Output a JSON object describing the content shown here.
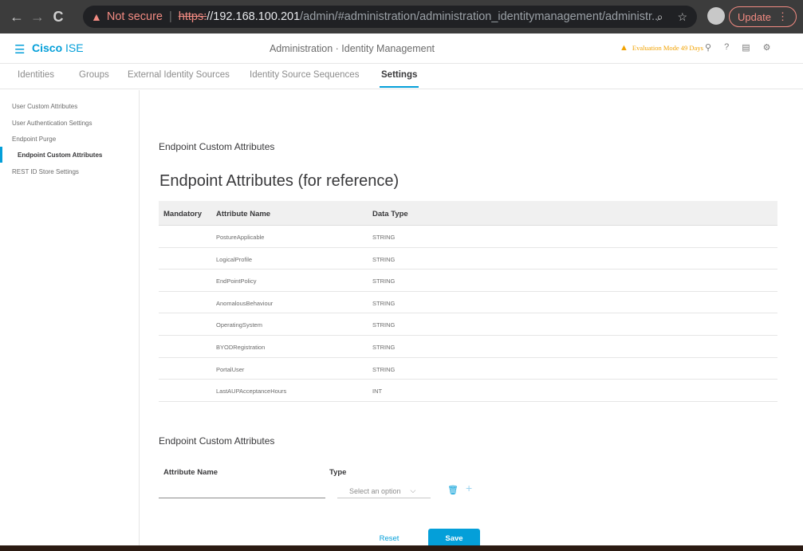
{
  "browser": {
    "back": "←",
    "forward": "→",
    "reload": "C",
    "not_secure": "Not secure",
    "url_scheme": "https:",
    "url_host": "//192.168.100.201",
    "url_path": "/admin/#administration/administration_identitymanagement/administr...",
    "update_label": "Update"
  },
  "app": {
    "brand_bold": "Cisco",
    "brand_light": " ISE",
    "heading": "Administration · Identity Management",
    "evaluation": "Evaluation Mode 49 Days"
  },
  "tabs": [
    {
      "label": "Identities"
    },
    {
      "label": "Groups"
    },
    {
      "label": "External Identity Sources"
    },
    {
      "label": "Identity Source Sequences"
    },
    {
      "label": "Settings"
    }
  ],
  "sidebar": {
    "items": [
      {
        "label": "User Custom Attributes"
      },
      {
        "label": "User Authentication Settings"
      },
      {
        "label": "Endpoint Purge"
      },
      {
        "label": "Endpoint Custom Attributes"
      },
      {
        "label": "REST ID Store Settings"
      }
    ]
  },
  "main": {
    "section_title": "Endpoint Custom Attributes",
    "reference_title": "Endpoint Attributes (for reference)",
    "table": {
      "columns": [
        "Mandatory",
        "Attribute Name",
        "Data Type"
      ],
      "rows": [
        {
          "mandatory": "",
          "name": "PostureApplicable",
          "type": "STRING"
        },
        {
          "mandatory": "",
          "name": "LogicalProfile",
          "type": "STRING"
        },
        {
          "mandatory": "",
          "name": "EndPointPolicy",
          "type": "STRING"
        },
        {
          "mandatory": "",
          "name": "AnomalousBehaviour",
          "type": "STRING"
        },
        {
          "mandatory": "",
          "name": "OperatingSystem",
          "type": "STRING"
        },
        {
          "mandatory": "",
          "name": "BYODRegistration",
          "type": "STRING"
        },
        {
          "mandatory": "",
          "name": "PortalUser",
          "type": "STRING"
        },
        {
          "mandatory": "",
          "name": "LastAUPAcceptanceHours",
          "type": "INT"
        }
      ]
    },
    "custom_title": "Endpoint Custom Attributes",
    "form": {
      "attribute_name_label": "Attribute Name",
      "attribute_name_value": "",
      "type_label": "Type",
      "type_placeholder": "Select an option"
    },
    "buttons": {
      "reset": "Reset",
      "save": "Save"
    }
  },
  "colors": {
    "accent": "#049fd9",
    "warning": "#f2a200"
  }
}
